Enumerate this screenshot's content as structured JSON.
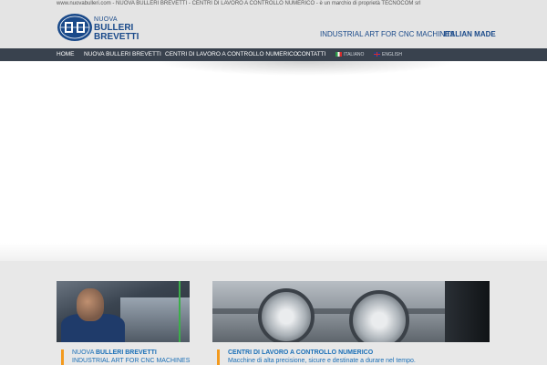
{
  "topbar": {
    "text": "www.nuovabulleri.com - NUOVA BULLERI BREVETTI - CENTRI DI LAVORO A CONTROLLO NUMERICO - è un marchio di proprietà TECNOCOM srl"
  },
  "logo": {
    "line1": "NUOVA",
    "line2": "BULLERI",
    "line3": "BREVETTI",
    "emblem_color": "#1a4a8a"
  },
  "header": {
    "tagline_1": "INDUSTRIAL ART FOR CNC MACHINES",
    "tagline_2": "ITALIAN MADE"
  },
  "nav": {
    "items": [
      {
        "label": "HOME",
        "active": true
      },
      {
        "label": "NUOVA BULLERI BREVETTI"
      },
      {
        "label": "CENTRI DI LAVORO A CONTROLLO NUMERICO"
      },
      {
        "label": "CONTATTI"
      }
    ],
    "languages": [
      {
        "label": "ITALIANO",
        "flag": "it-flag-icon"
      },
      {
        "label": "ENGLISH",
        "flag": "uk-flag-icon"
      }
    ]
  },
  "colors": {
    "accent": "#f39a1e",
    "nav_bg": "#39424e",
    "brand_blue": "#1a4a8a",
    "link_blue": "#1a6fb7"
  },
  "features": [
    {
      "title_light": "NUOVA ",
      "title_bold": "BULLERI BREVETTI",
      "subtitle": "INDUSTRIAL ART FOR CNC MACHINES"
    },
    {
      "title_light": "",
      "title_bold": "CENTRI DI LAVORO A CONTROLLO NUMERICO",
      "subtitle": "Macchine di alta precisione, sicure e destinate a durare nel tempo."
    }
  ]
}
